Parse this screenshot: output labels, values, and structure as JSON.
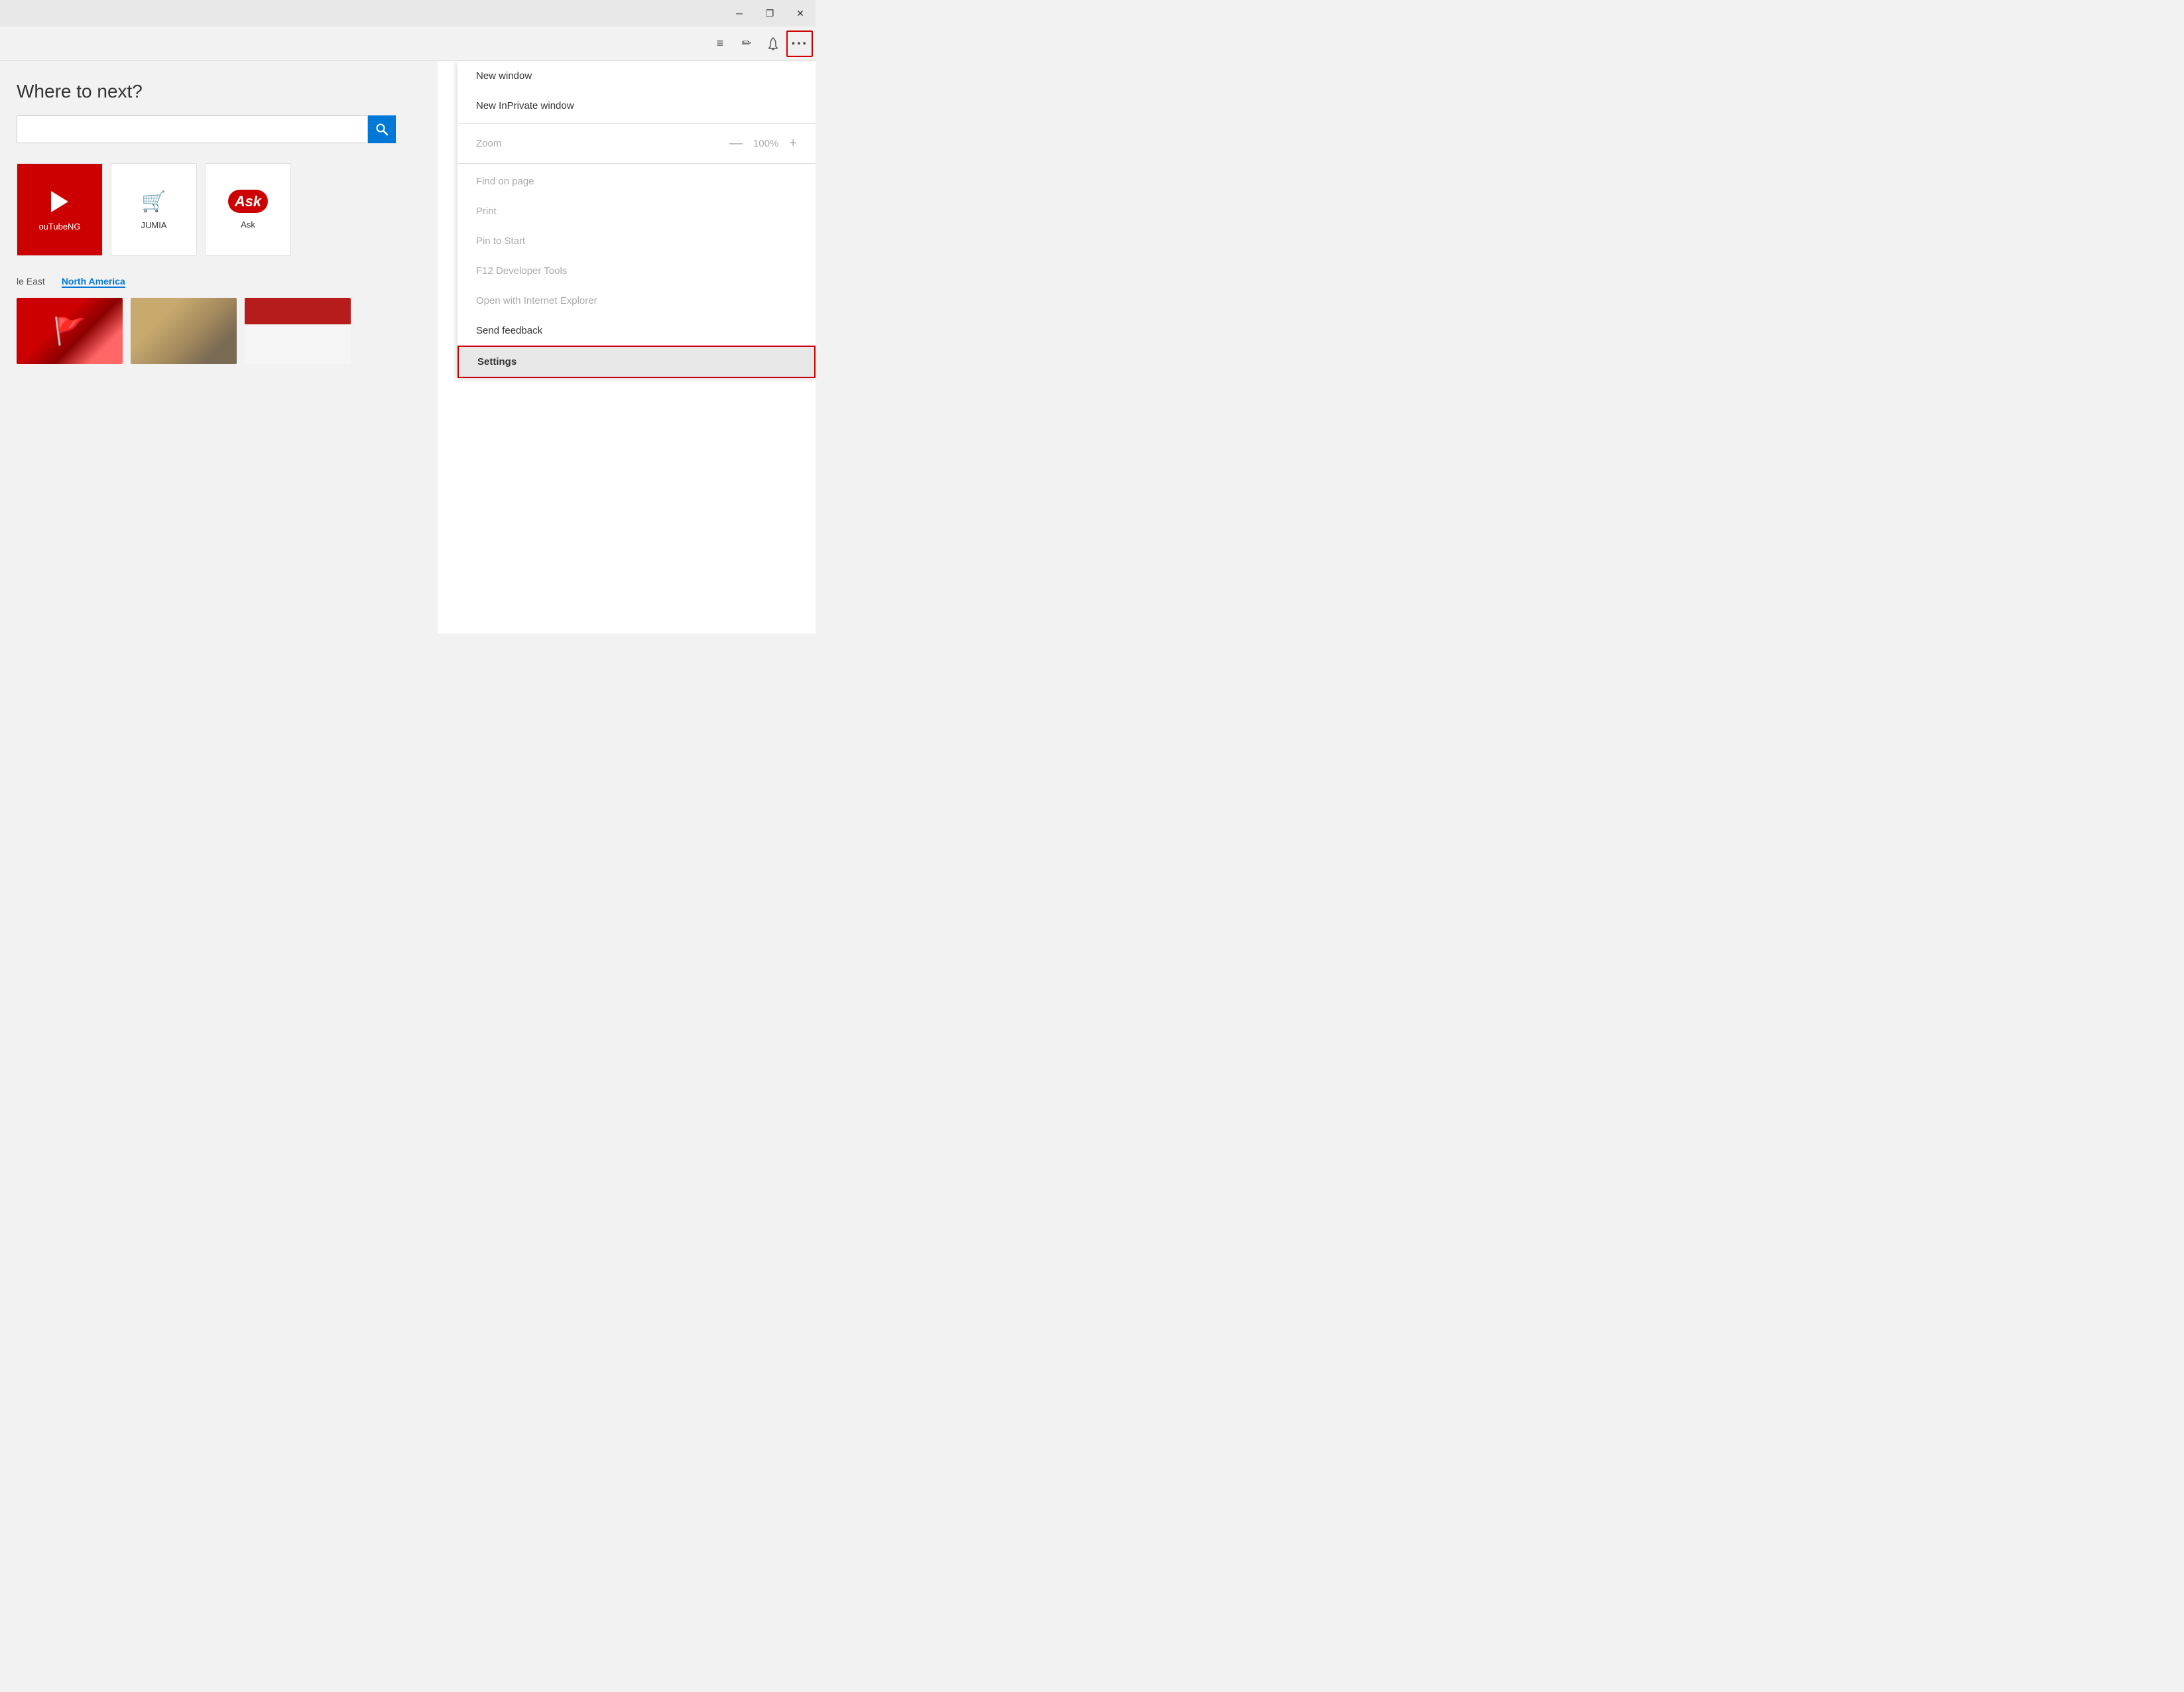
{
  "titleBar": {
    "minimizeLabel": "─",
    "restoreLabel": "❐",
    "closeLabel": "✕"
  },
  "toolbar": {
    "hamburgerIcon": "≡",
    "editIcon": "✏",
    "notificationIcon": "🔔",
    "moreIcon": "···"
  },
  "page": {
    "whereNext": "Where to next?",
    "searchPlaceholder": "",
    "newsTabs": [
      "le East",
      "North America"
    ],
    "tiles": [
      {
        "id": "youtube",
        "label": "ouTubeNG"
      },
      {
        "id": "jumia",
        "label": "JUMIA"
      },
      {
        "id": "ask",
        "label": "Ask"
      }
    ]
  },
  "menu": {
    "items": [
      {
        "id": "new-window",
        "label": "New window",
        "disabled": false,
        "type": "item"
      },
      {
        "id": "new-inprivate",
        "label": "New InPrivate window",
        "disabled": false,
        "type": "item"
      },
      {
        "id": "separator1",
        "type": "separator"
      },
      {
        "id": "zoom",
        "label": "Zoom",
        "type": "zoom",
        "value": "100%",
        "disabled": true
      },
      {
        "id": "separator2",
        "type": "separator"
      },
      {
        "id": "find",
        "label": "Find on page",
        "disabled": true,
        "type": "item"
      },
      {
        "id": "print",
        "label": "Print",
        "disabled": true,
        "type": "item"
      },
      {
        "id": "pin",
        "label": "Pin to Start",
        "disabled": true,
        "type": "item"
      },
      {
        "id": "f12",
        "label": "F12 Developer Tools",
        "disabled": true,
        "type": "item"
      },
      {
        "id": "open-ie",
        "label": "Open with Internet Explorer",
        "disabled": true,
        "type": "item"
      },
      {
        "id": "feedback",
        "label": "Send feedback",
        "disabled": false,
        "type": "item"
      },
      {
        "id": "settings",
        "label": "Settings",
        "disabled": false,
        "type": "item",
        "highlighted": true
      }
    ],
    "zoomMinus": "—",
    "zoomPlus": "+"
  }
}
